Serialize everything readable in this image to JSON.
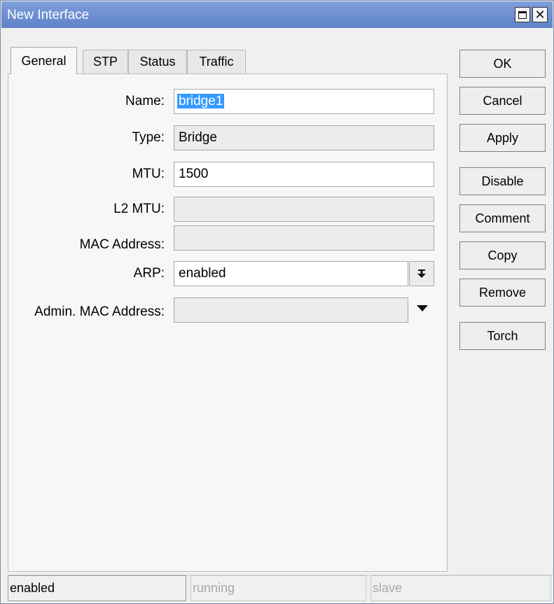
{
  "window": {
    "title": "New Interface"
  },
  "tabs": [
    {
      "label": "General",
      "active": true
    },
    {
      "label": "STP",
      "active": false
    },
    {
      "label": "Status",
      "active": false
    },
    {
      "label": "Traffic",
      "active": false
    }
  ],
  "form": {
    "name": {
      "label": "Name:",
      "value": "bridge1"
    },
    "type": {
      "label": "Type:",
      "value": "Bridge"
    },
    "mtu": {
      "label": "MTU:",
      "value": "1500"
    },
    "l2mtu": {
      "label": "L2 MTU:",
      "value": ""
    },
    "mac": {
      "label": "MAC Address:",
      "value": ""
    },
    "arp": {
      "label": "ARP:",
      "value": "enabled"
    },
    "admin_mac": {
      "label": "Admin. MAC Address:",
      "value": ""
    }
  },
  "buttons": {
    "ok": "OK",
    "cancel": "Cancel",
    "apply": "Apply",
    "disable": "Disable",
    "comment": "Comment",
    "copy": "Copy",
    "remove": "Remove",
    "torch": "Torch"
  },
  "status": {
    "state": "enabled",
    "running": "running",
    "slave": "slave"
  },
  "colors": {
    "titlebar": "#6b8ecf",
    "selection": "#3399ff"
  }
}
